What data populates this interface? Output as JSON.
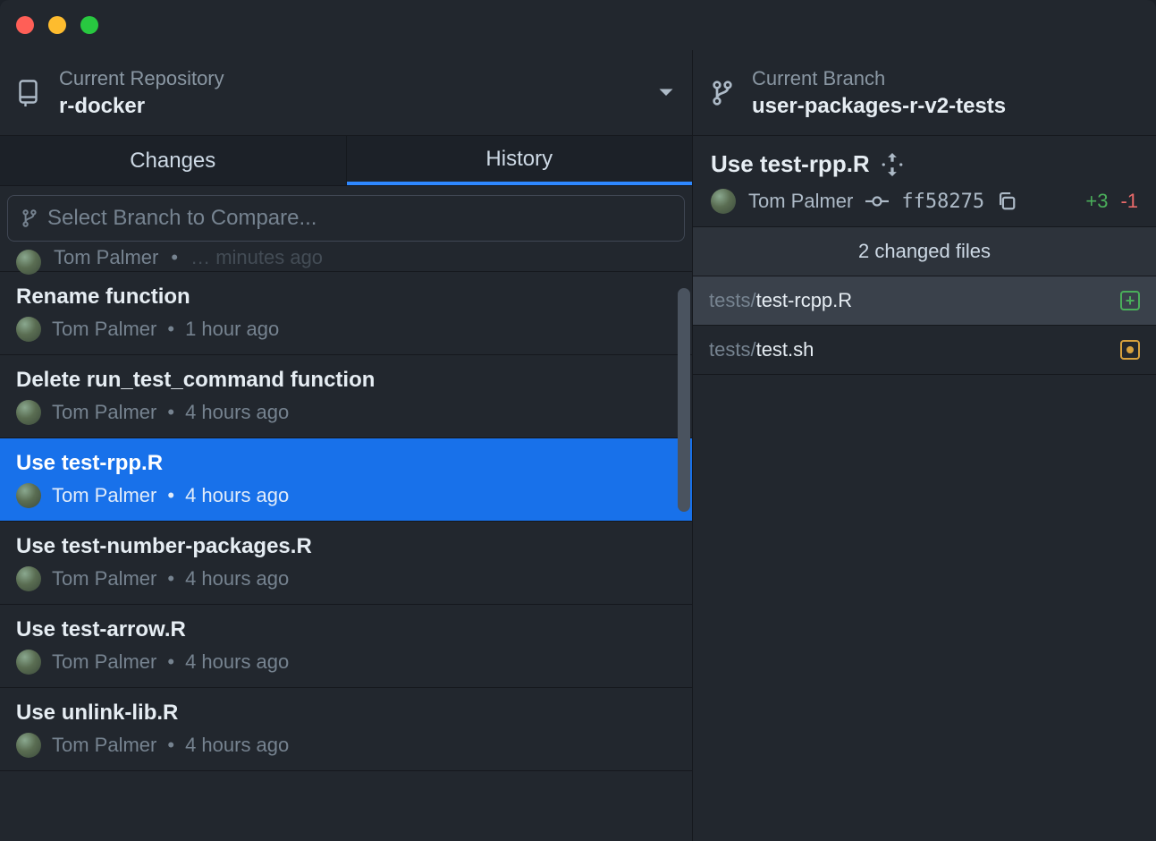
{
  "header": {
    "repo_label": "Current Repository",
    "repo_name": "r-docker",
    "branch_label": "Current Branch",
    "branch_name": "user-packages-r-v2-tests"
  },
  "tabs": {
    "changes": "Changes",
    "history": "History"
  },
  "compare": {
    "placeholder": "Select Branch to Compare..."
  },
  "partial_commit": {
    "author": "Tom Palmer",
    "time_suffix": "minutes ago"
  },
  "commits": [
    {
      "title": "Rename function",
      "author": "Tom Palmer",
      "time": "1 hour ago",
      "selected": false
    },
    {
      "title": "Delete run_test_command function",
      "author": "Tom Palmer",
      "time": "4 hours ago",
      "selected": false
    },
    {
      "title": "Use test-rpp.R",
      "author": "Tom Palmer",
      "time": "4 hours ago",
      "selected": true
    },
    {
      "title": "Use test-number-packages.R",
      "author": "Tom Palmer",
      "time": "4 hours ago",
      "selected": false
    },
    {
      "title": "Use test-arrow.R",
      "author": "Tom Palmer",
      "time": "4 hours ago",
      "selected": false
    },
    {
      "title": "Use unlink-lib.R",
      "author": "Tom Palmer",
      "time": "4 hours ago",
      "selected": false
    }
  ],
  "detail": {
    "title": "Use test-rpp.R",
    "author": "Tom Palmer",
    "sha": "ff58275",
    "additions": "+3",
    "deletions": "-1",
    "changed_files_label": "2 changed files",
    "files": [
      {
        "dir": "tests/",
        "name": "test-rcpp.R",
        "status": "added",
        "selected": true
      },
      {
        "dir": "tests/",
        "name": "test.sh",
        "status": "modified",
        "selected": false
      }
    ]
  }
}
